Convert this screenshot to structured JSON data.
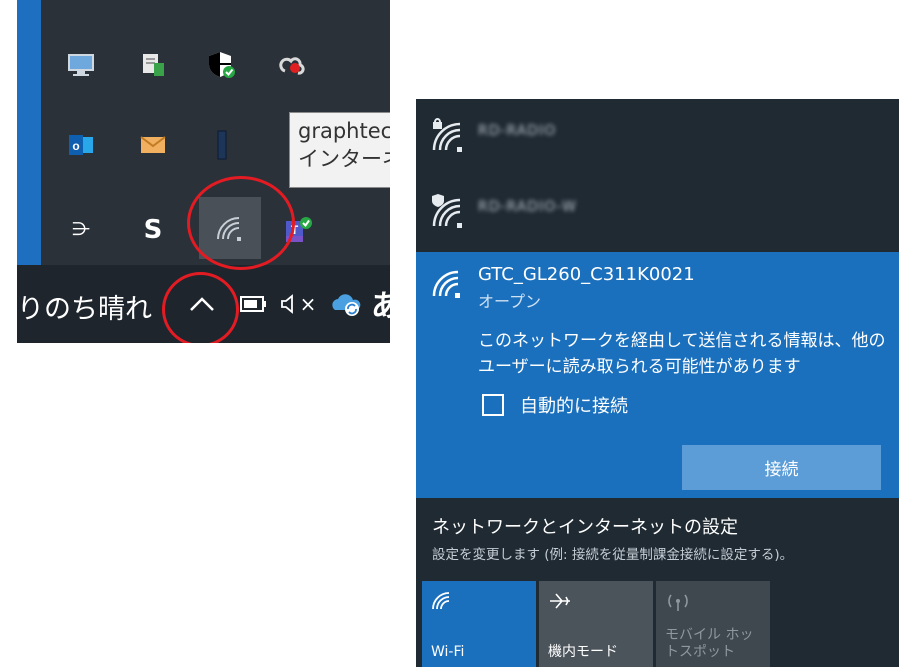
{
  "tray": {
    "tooltip_line1": "graphtec.co",
    "tooltip_line2": "インターネット",
    "icons": [
      "monitor-icon",
      "network-drive-icon",
      "security-shield-icon",
      "cloud-sync-icon",
      "outlook-icon",
      "mail-icon",
      "usb-device-icon",
      "wifi-icon",
      "arrows-app-icon",
      "skype-icon",
      "teams-icon"
    ]
  },
  "taskbar": {
    "weather": "りのち晴れ",
    "chevron": "^",
    "volume_mute": "×",
    "ime": "あ"
  },
  "network": {
    "networks": [
      {
        "name": "RD-RADIO",
        "secure": true
      },
      {
        "name": "RD-RADIO-W",
        "secure": true
      }
    ],
    "selected": {
      "ssid": "GTC_GL260_C311K0021",
      "status": "オープン",
      "warning": "このネットワークを経由して送信される情報は、他のユーザーに読み取られる可能性があります",
      "auto_connect_label": "自動的に接続",
      "connect_label": "接続"
    },
    "settings_link": "ネットワークとインターネットの設定",
    "settings_desc": "設定を変更します (例: 接続を従量制課金接続に設定する)。",
    "quick_actions": [
      {
        "label": "Wi-Fi",
        "active": true
      },
      {
        "label": "機内モード",
        "active": false
      },
      {
        "label": "モバイル ホットスポット",
        "active": false
      }
    ]
  },
  "colors": {
    "accent": "#1b70bd",
    "annotation_red": "#e31b23",
    "flyout_bg": "#1f2a33"
  }
}
